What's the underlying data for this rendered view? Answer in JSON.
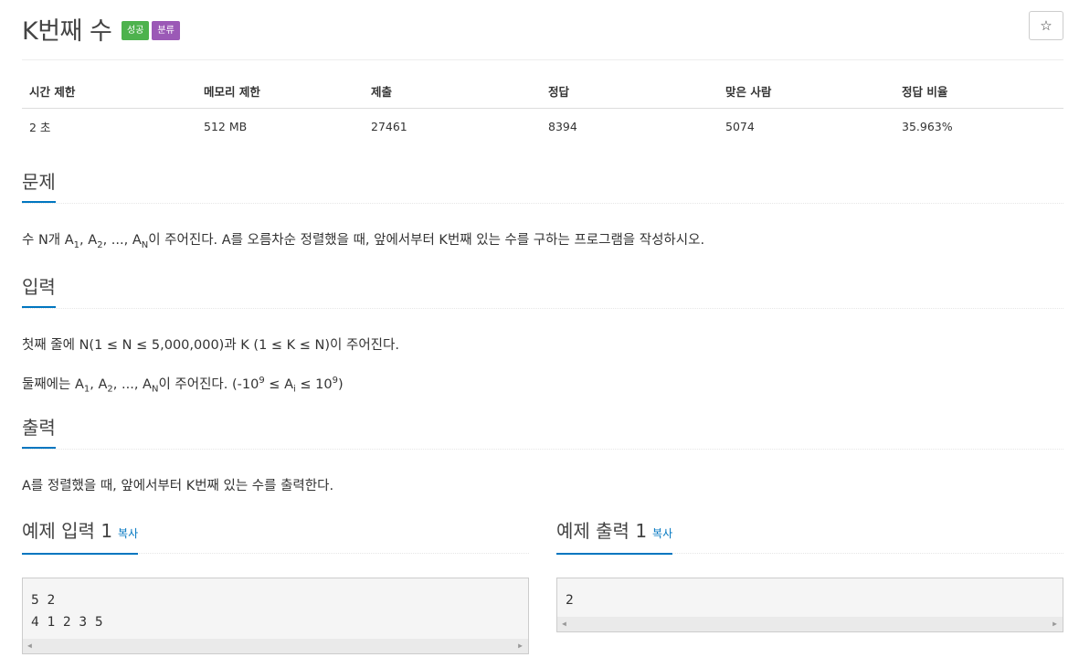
{
  "title": "K번째 수",
  "badges": {
    "result": "성공",
    "category": "분류"
  },
  "star_icon": "star-icon",
  "info_table": {
    "headers": [
      "시간 제한",
      "메모리 제한",
      "제출",
      "정답",
      "맞은 사람",
      "정답 비율"
    ],
    "values": [
      "2 초",
      "512 MB",
      "27461",
      "8394",
      "5074",
      "35.963%"
    ]
  },
  "problem": {
    "heading": "문제",
    "text_a": "수 N개 A",
    "sub1": "1",
    "text_b": ", A",
    "sub2": "2",
    "text_c": ", ..., A",
    "subN": "N",
    "text_d": "이 주어진다. A를 오름차순 정렬했을 때, 앞에서부터 K번째 있는 수를 구하는 프로그램을 작성하시오."
  },
  "input": {
    "heading": "입력",
    "line1": "첫째 줄에 N(1 ≤ N ≤ 5,000,000)과 K (1 ≤ K ≤ N)이 주어진다.",
    "line2_a": "둘째에는 A",
    "line2_sub1": "1",
    "line2_b": ", A",
    "line2_sub2": "2",
    "line2_c": ", ..., A",
    "line2_subN": "N",
    "line2_d": "이 주어진다. (-10",
    "line2_sup1": "9",
    "line2_e": " ≤ A",
    "line2_subi": "i",
    "line2_f": " ≤ 10",
    "line2_sup2": "9",
    "line2_g": ")"
  },
  "output": {
    "heading": "출력",
    "text": "A를 정렬했을 때, 앞에서부터 K번째 있는 수를 출력한다."
  },
  "example_input": {
    "heading": "예제 입력 1",
    "copy": "복사",
    "lines": "5 2\n4 1 2 3 5"
  },
  "example_output": {
    "heading": "예제 출력 1",
    "copy": "복사",
    "lines": "2"
  }
}
